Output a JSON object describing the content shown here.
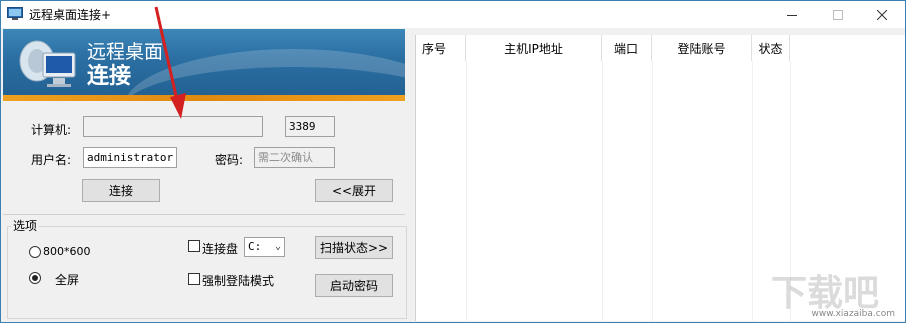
{
  "window": {
    "title": "远程桌面连接+",
    "min_icon": "minimize-icon",
    "max_icon": "maximize-icon",
    "close_icon": "close-icon"
  },
  "banner": {
    "line1": "远程桌面",
    "line2": "连接",
    "icon": "remote-desktop-icon"
  },
  "form": {
    "computer_label": "计算机:",
    "computer_value": "",
    "port_value": "3389",
    "username_label": "用户名:",
    "username_value": "administrator",
    "password_label": "密码:",
    "password_placeholder": "需二次确认",
    "connect_button": "连接",
    "expand_button": "<<展开"
  },
  "options": {
    "group_label": "选项",
    "res_800": "800*600",
    "res_800_selected": false,
    "fullscreen": "全屏",
    "fullscreen_selected": true,
    "connect_disk_label": "连接盘",
    "connect_disk_checked": false,
    "disk_value": "C:",
    "force_login_label": "强制登陆模式",
    "force_login_checked": false,
    "scan_button": "扫描状态>>",
    "start_password_button": "启动密码"
  },
  "list": {
    "columns": [
      "序号",
      "主机IP地址",
      "端口",
      "登陆账号",
      "状态"
    ],
    "rows": []
  },
  "colors": {
    "banner_blue": "#2b6fa3",
    "banner_orange": "#f0a020",
    "annotation_arrow": "#d42020"
  },
  "watermark": "www.xiazaiba.com"
}
